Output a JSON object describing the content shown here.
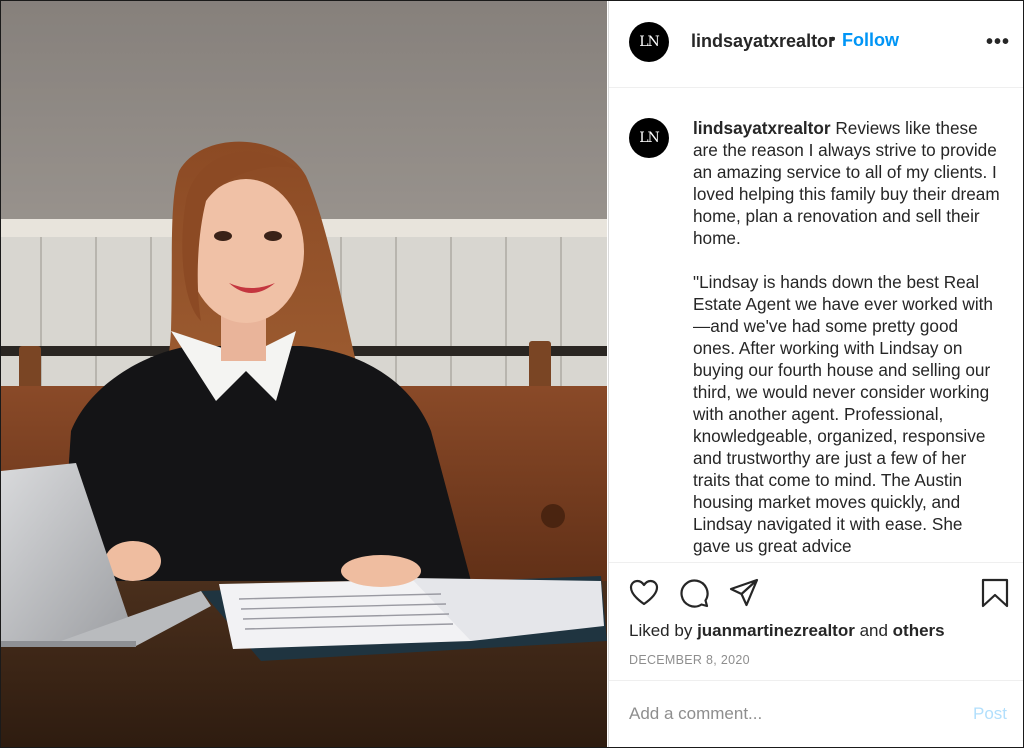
{
  "header": {
    "avatar_text": "LN",
    "username": "lindsayatxrealtor",
    "separator": "•",
    "follow_label": "Follow",
    "more_label": "•••"
  },
  "caption": {
    "avatar_text": "LN",
    "username": "lindsayatxrealtor",
    "paragraph1": "Reviews like these are the reason I always strive to provide an amazing service to all of my clients. I loved helping this family buy their dream home, plan a renovation and sell their home.",
    "paragraph2": "\"Lindsay is hands down the best Real Estate Agent we have ever worked with—and we've had some pretty good ones. After working with Lindsay on buying our fourth house and selling our third, we would never consider working with another agent. Professional, knowledgeable, organized, responsive and trustworthy are just a few of her traits that come to mind. The Austin housing market moves quickly, and Lindsay navigated it with ease. She gave us great advice"
  },
  "actions": {
    "icons": [
      "heart-icon",
      "comment-icon",
      "share-icon",
      "bookmark-icon"
    ]
  },
  "likes": {
    "prefix": "Liked by",
    "user": "juanmartinezrealtor",
    "conjunction": "and",
    "others": "others"
  },
  "date": "DECEMBER 8, 2020",
  "comment_box": {
    "placeholder": "Add a comment...",
    "post_label": "Post"
  },
  "colors": {
    "link_blue": "#0095f6",
    "post_disabled": "#b2dffc",
    "text": "#262626",
    "muted": "#8e8e8e"
  }
}
